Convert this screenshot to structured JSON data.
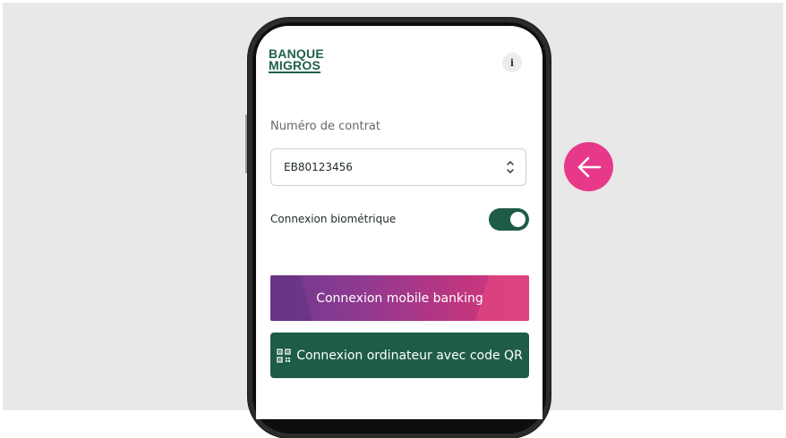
{
  "app": {
    "logo_line1": "BANQUE",
    "logo_line2": "MIGROS",
    "info_icon": "i"
  },
  "contract": {
    "label": "Numéro de contrat",
    "value": "EB80123456"
  },
  "biometric": {
    "label": "Connexion biométrique",
    "enabled": true
  },
  "buttons": {
    "mobile_banking": "Connexion mobile banking",
    "qr_login": "Connexion ordinateur avec code QR"
  },
  "icons": {
    "info": "info-icon",
    "select_chevrons": "chevron-up-down-icon",
    "qr": "qr-code-icon",
    "back": "arrow-left-icon"
  },
  "colors": {
    "brand_green": "#1e5c48",
    "accent_pink": "#e8388a",
    "gradient_start": "#6c3a8c",
    "gradient_end": "#d83b84",
    "background": "#e8e8e8"
  }
}
